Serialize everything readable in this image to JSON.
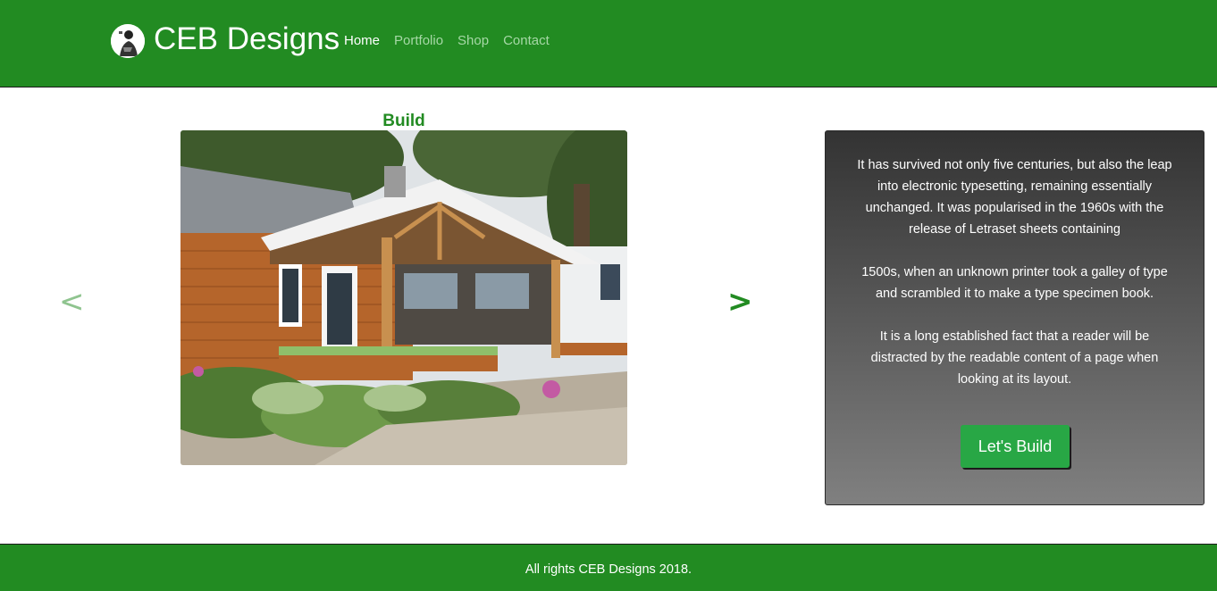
{
  "header": {
    "brand": "CEB Designs",
    "logo_icon": "person-portrait-icon",
    "nav": [
      {
        "label": "Home",
        "active": true
      },
      {
        "label": "Portfolio",
        "active": false
      },
      {
        "label": "Shop",
        "active": false
      },
      {
        "label": "Contact",
        "active": false
      }
    ]
  },
  "carousel": {
    "title": "Build",
    "prev_label": "<",
    "next_label": ">",
    "image_subject": "house-with-covered-porch-and-garden-photo"
  },
  "card": {
    "paragraphs": [
      "It has survived not only five centuries, but also the leap into electronic typesetting, remaining essentially unchanged. It was popularised in the 1960s with the release of Letraset sheets containing",
      "1500s, when an unknown printer took a galley of type and scrambled it to make a type specimen book.",
      "It is a long established fact that a reader will be distracted by the readable content of a page when looking at its layout."
    ],
    "cta_label": "Let's Build"
  },
  "footer": {
    "text": "All rights CEB Designs 2018."
  },
  "colors": {
    "brand_green": "#228b22",
    "button_green": "#28a745",
    "card_top": "#333333",
    "card_bottom": "#808080"
  }
}
